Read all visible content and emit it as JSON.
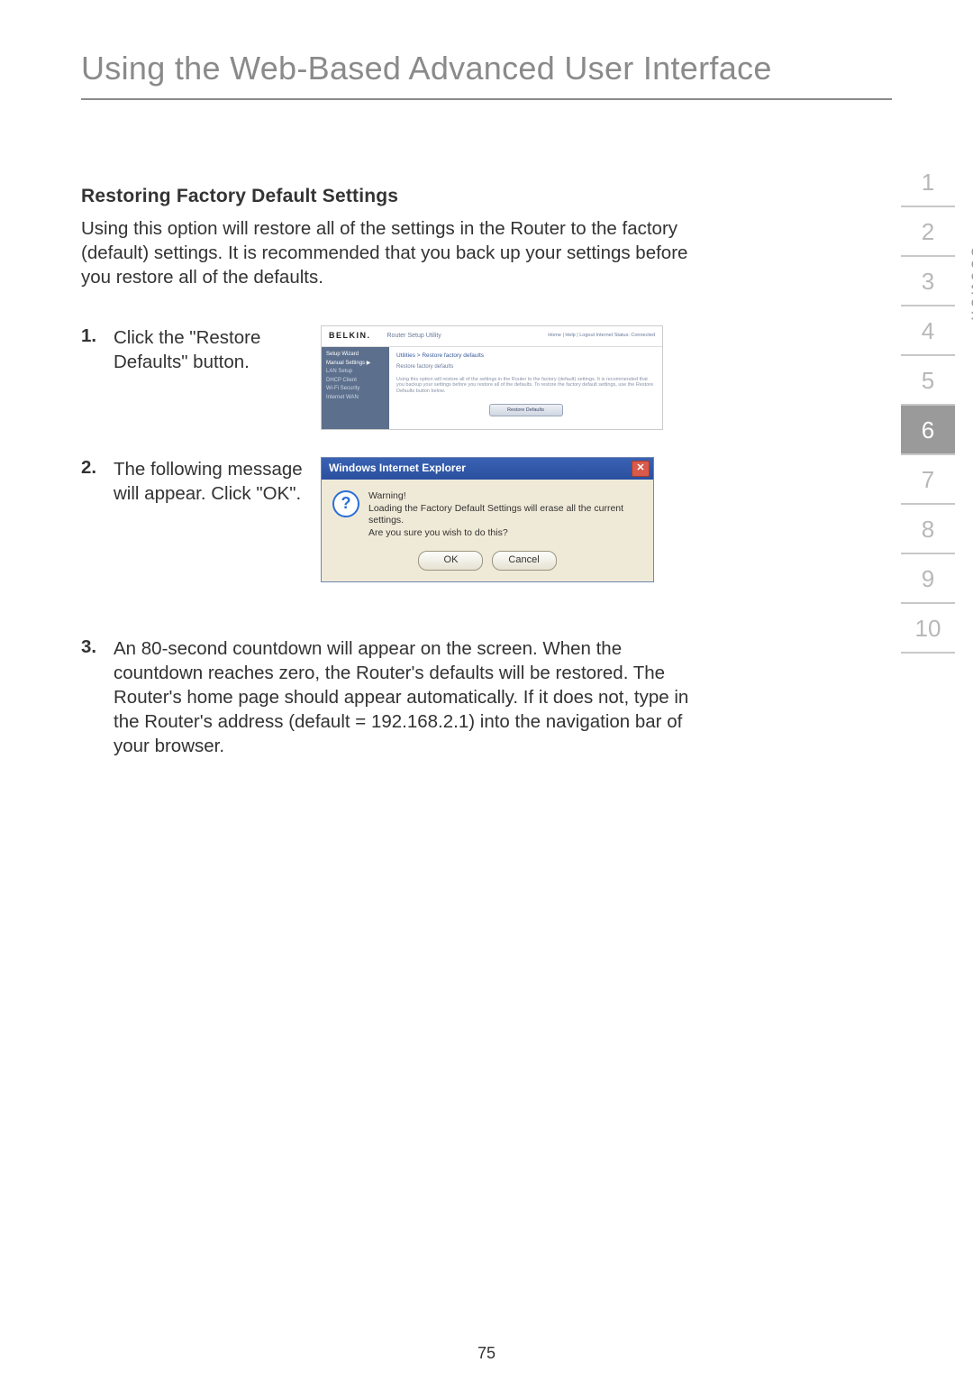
{
  "title": "Using the Web-Based Advanced User Interface",
  "subheading": "Restoring Factory Default Settings",
  "intro": "Using this option will restore all of the settings in the Router to the factory (default) settings. It is recommended that you back up your settings before you restore all of the defaults.",
  "steps": [
    {
      "num": "1.",
      "text": "Click the \"Restore Defaults\" button."
    },
    {
      "num": "2.",
      "text": "The following message will appear. Click \"OK\"."
    },
    {
      "num": "3.",
      "text": "An 80-second countdown will appear on the screen. When the countdown reaches zero, the Router's defaults will be restored. The Router's home page should appear automatically. If it does not, type in the Router's address (default = 192.168.2.1) into the navigation bar of your browser."
    }
  ],
  "router": {
    "logo": "BELKIN.",
    "title": "Router Setup Utility",
    "status": "Home | Help | Logout   Internet Status: Connected",
    "side": {
      "i0": "Setup Wizard",
      "i1": "Manual Settings ▶",
      "i2": "LAN Setup",
      "i3": "DHCP Client",
      "i4": "Wi-Fi Security",
      "i5": "Internet WAN"
    },
    "breadcrumb": "Utilities > Restore factory defaults",
    "sub": "Restore factory defaults",
    "desc": "Using this option will restore all of the settings in the Router to the factory (default) settings. It is recommended that you backup your settings before you restore all of the defaults. To restore the factory default settings, use the Restore Defaults button below.",
    "button": "Restore Defaults"
  },
  "dialog": {
    "title": "Windows Internet Explorer",
    "warning": "Warning!",
    "line1": "Loading the Factory Default Settings will erase all the current settings.",
    "line2": "Are you sure you wish to do this?",
    "ok": "OK",
    "cancel": "Cancel",
    "close": "✕"
  },
  "section_nav": {
    "label": "section",
    "items": [
      "1",
      "2",
      "3",
      "4",
      "5",
      "6",
      "7",
      "8",
      "9",
      "10"
    ],
    "active": "6"
  },
  "page_number": "75"
}
